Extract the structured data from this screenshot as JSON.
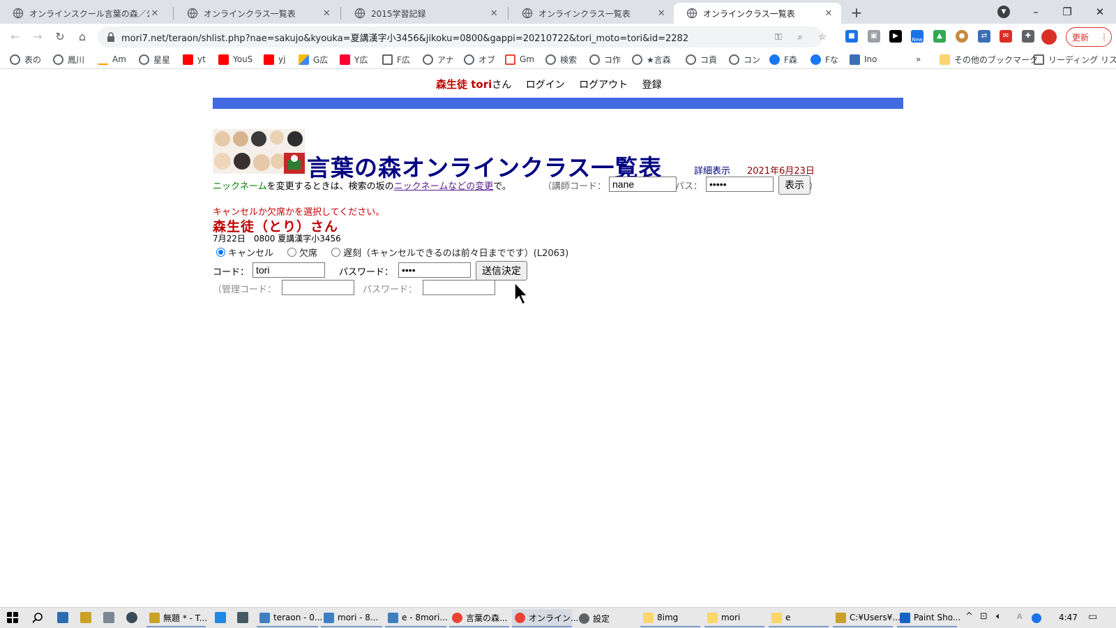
{
  "browser": {
    "tabs": [
      {
        "title": "オンラインスクール言葉の森／公式ホ",
        "active": false
      },
      {
        "title": "オンラインクラス一覧表",
        "active": false
      },
      {
        "title": "2015学習記録",
        "active": false
      },
      {
        "title": "オンラインクラス一覧表",
        "active": false
      },
      {
        "title": "オンラインクラス一覧表",
        "active": true
      }
    ],
    "new_tab_symbol": "+",
    "url": "mori7.net/teraon/shlist.php?nae=sakujo&kyouka=夏講漢字小3456&jikoku=0800&gappi=20210722&tori_moto=tori&id=2282",
    "update_button": "更新",
    "ext_new_badge": "New",
    "bookmarks": [
      {
        "label": "表の",
        "icon": "globe"
      },
      {
        "label": "鳳川",
        "icon": "globe"
      },
      {
        "label": "Am",
        "icon": "amazon"
      },
      {
        "label": "星星",
        "icon": "globe"
      },
      {
        "label": "yt",
        "icon": "youtube"
      },
      {
        "label": "YouS",
        "icon": "youtube"
      },
      {
        "label": "yj",
        "icon": "youtube"
      },
      {
        "label": "G広",
        "icon": "google-ads"
      },
      {
        "label": "Y広",
        "icon": "yahoo"
      },
      {
        "label": "F広",
        "icon": "doc"
      },
      {
        "label": "アナ",
        "icon": "globe"
      },
      {
        "label": "オブ",
        "icon": "globe"
      },
      {
        "label": "Gm",
        "icon": "gmail"
      },
      {
        "label": "検索",
        "icon": "globe"
      },
      {
        "label": "コ作",
        "icon": "globe"
      },
      {
        "label": "★言森",
        "icon": "globe"
      },
      {
        "label": "コ貢",
        "icon": "globe"
      },
      {
        "label": "コン",
        "icon": "globe"
      },
      {
        "label": "F森",
        "icon": "facebook"
      },
      {
        "label": "Fな",
        "icon": "facebook"
      },
      {
        "label": "Ino",
        "icon": "ino"
      }
    ],
    "more_bookmarks": "»",
    "other_bookmarks": "その他のブックマーク",
    "reading_list": "リーディング リスト"
  },
  "page": {
    "user_name": "森生徒 tori",
    "user_suffix": "さん",
    "login": "ログイン",
    "logout": "ログアウト",
    "register": "登録",
    "title": "言葉の森オンラインクラス一覧表",
    "detail_link": "詳細表示",
    "date": "2021年6月23日",
    "nick_word": "ニックネーム",
    "nick_text1": "を変更するときは、検索の坂の",
    "nick_link": "ニックネームなどの変更",
    "nick_text2": "で。",
    "teacher_code_label": "（講師コード：",
    "teacher_code_value": "nane",
    "pass_label": "パス：",
    "pass_value": "•••••",
    "show_button": "表示",
    "close_paren": "）",
    "instruction": "キャンセルか欠席かを選択してください。",
    "student_name": "森生徒（とり）さん",
    "lesson": "7月22日　0800  夏講漢字小3456",
    "radio_options": [
      {
        "label": "キャンセル",
        "checked": true
      },
      {
        "label": "欠席",
        "checked": false
      },
      {
        "label": "遅刻（キャンセルできるのは前々日までです）(L2063)",
        "checked": false
      }
    ],
    "code_label": "コード：",
    "code_value": "tori",
    "password_label": "パスワード：",
    "password_value": "••••",
    "submit_button": "送信決定",
    "admin_code_label": "（管理コード：",
    "admin_password_label": "パスワード：",
    "admin_code_value": "",
    "admin_password_value": ""
  },
  "taskbar": {
    "items": [
      {
        "label": "無題 * - T..."
      },
      {
        "label": "teraon - 0..."
      },
      {
        "label": "mori - 8..."
      },
      {
        "label": "e - 8mori..."
      },
      {
        "label": "言葉の森..."
      },
      {
        "label": "オンライン..."
      },
      {
        "label": "設定"
      },
      {
        "label": "8img"
      },
      {
        "label": "mori"
      },
      {
        "label": "e"
      },
      {
        "label": "C:¥Users¥..."
      },
      {
        "label": "Paint Sho..."
      }
    ],
    "clock": "4:47"
  },
  "colors": {
    "accent_blue": "#4169e1",
    "title_navy": "#000080",
    "alert_red": "#c00000",
    "nick_green": "#008000"
  }
}
